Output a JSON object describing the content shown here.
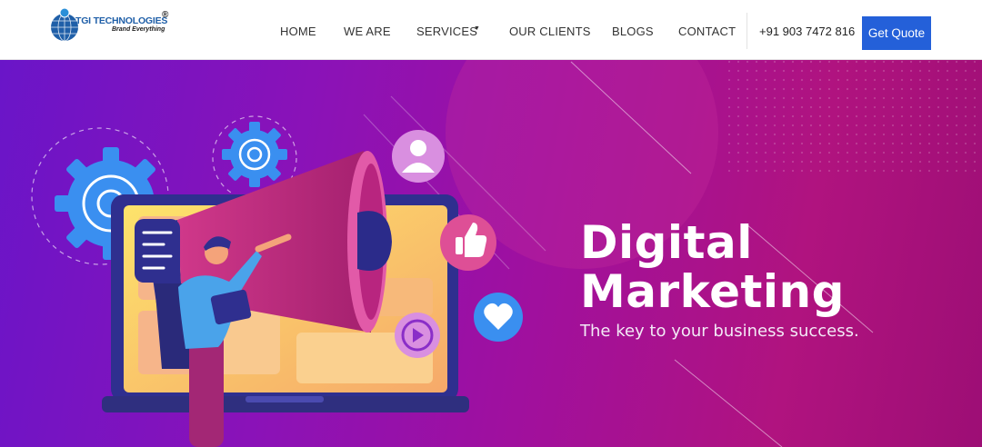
{
  "brand": {
    "name": "TGI TECHNOLOGIES",
    "registered": "®",
    "tagline": "Brand Everything",
    "brand_color": "#1f5fa8"
  },
  "nav": {
    "items": [
      {
        "label": "HOME"
      },
      {
        "label": "WE ARE"
      },
      {
        "label": "SERVICES",
        "has_dropdown": true
      },
      {
        "label": "OUR CLIENTS"
      },
      {
        "label": "BLOGS"
      },
      {
        "label": "CONTACT"
      }
    ],
    "phone": "+91 903 7472 816",
    "cta_label": "Get Quote",
    "cta_color": "#2460d9"
  },
  "hero": {
    "title": "Digital\nMarketing",
    "subtitle": "The key to your business success.",
    "gradient_colors": [
      "#6a15c8",
      "#a0109e",
      "#b0137f"
    ],
    "illustration_icons": [
      "gear-icon",
      "user-icon",
      "thumbs-up-icon",
      "heart-icon",
      "play-icon",
      "megaphone-icon"
    ]
  }
}
